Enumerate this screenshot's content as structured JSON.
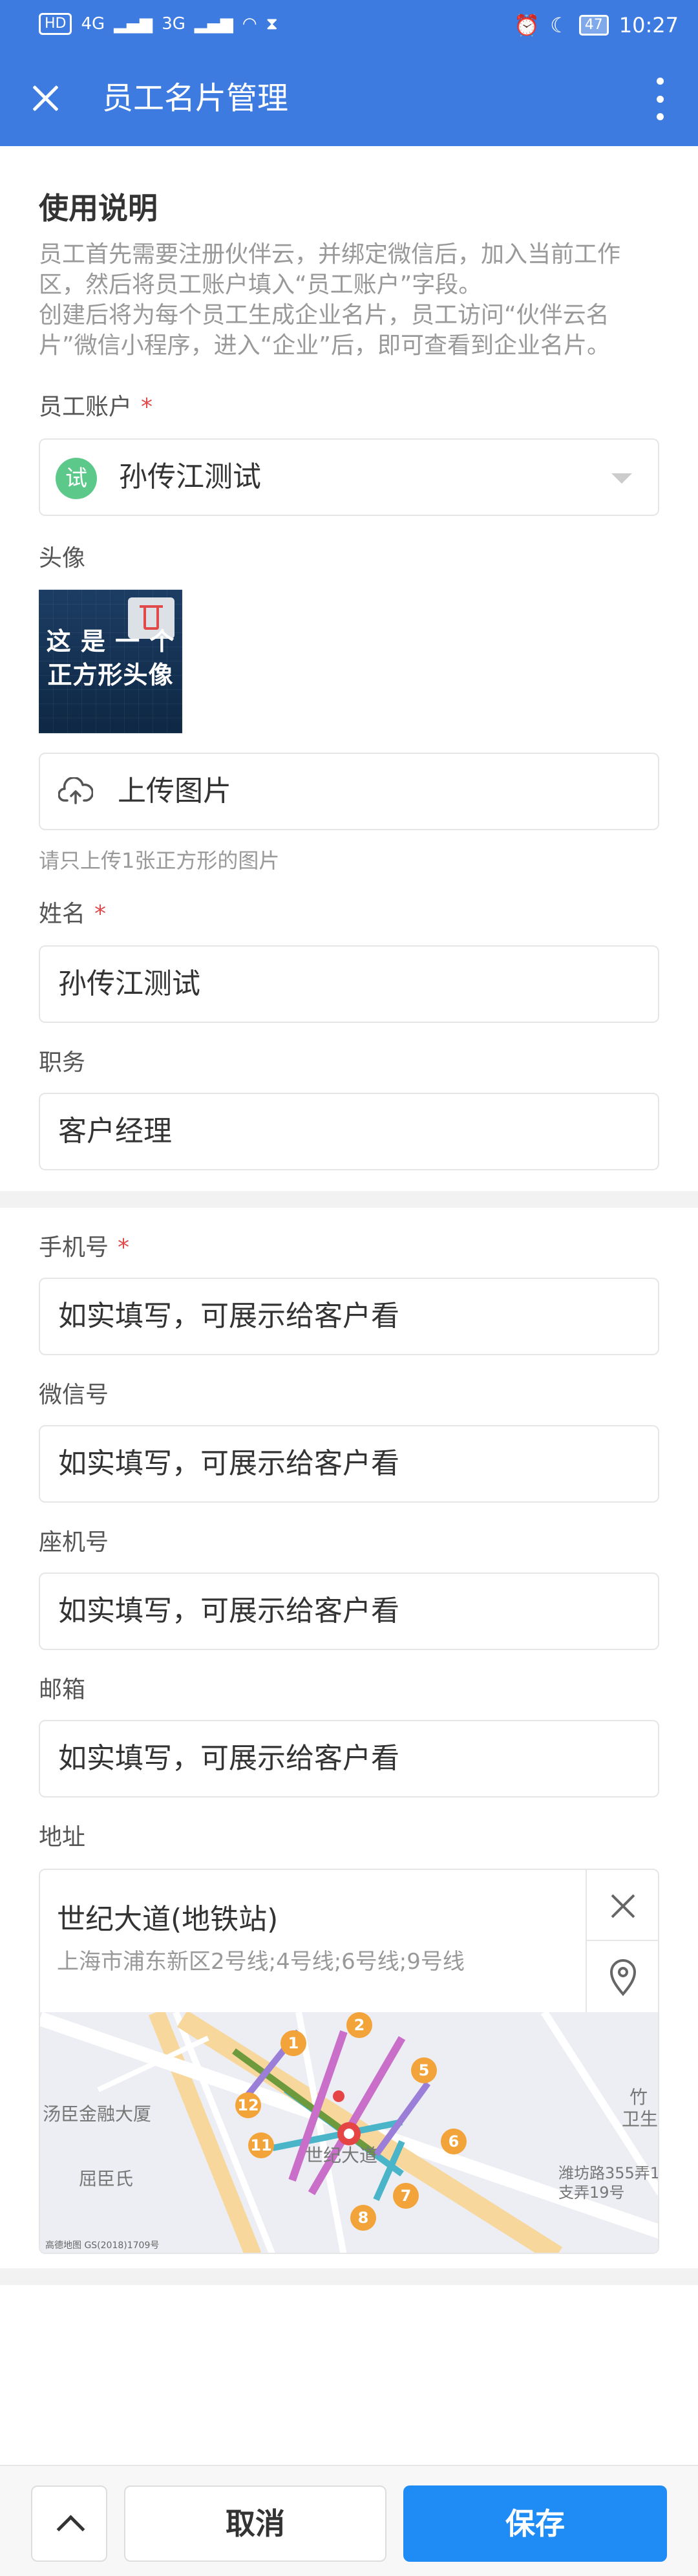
{
  "status_bar": {
    "left_indicators": [
      "HD",
      "4G",
      "3G"
    ],
    "time": "10:27",
    "battery": "47"
  },
  "app_bar": {
    "title": "员工名片管理"
  },
  "instructions": {
    "title": "使用说明",
    "paragraph_1": "员工首先需要注册伙伴云，并绑定微信后，加入当前工作区，然后将员工账户填入“员工账户”字段。",
    "paragraph_2": "创建后将为每个员工生成企业名片，员工访问“伙伴云名片”微信小程序，进入“企业”后，即可查看到企业名片。"
  },
  "form": {
    "account": {
      "label": "员工账户",
      "required_mark": "*",
      "badge": "试",
      "value": "孙传江测试"
    },
    "avatar": {
      "label": "头像",
      "image_caption_line1": "这 是 一 个",
      "image_caption_line2": "正方形头像",
      "upload_label": "上传图片",
      "hint": "请只上传1张正方形的图片"
    },
    "name": {
      "label": "姓名",
      "required_mark": "*",
      "value": "孙传江测试"
    },
    "position": {
      "label": "职务",
      "value": "客户经理"
    },
    "phone": {
      "label": "手机号",
      "required_mark": "*",
      "placeholder": "如实填写，可展示给客户看"
    },
    "wechat": {
      "label": "微信号",
      "placeholder": "如实填写，可展示给客户看"
    },
    "landline": {
      "label": "座机号",
      "placeholder": "如实填写，可展示给客户看"
    },
    "email": {
      "label": "邮箱",
      "placeholder": "如实填写，可展示给客户看"
    },
    "address": {
      "label": "地址",
      "name": "世纪大道(地铁站)",
      "detail": "上海市浦东新区2号线;4号线;6号线;9号线",
      "map": {
        "labels": [
          "汤臣金融大厦",
          "屈臣氏",
          "世纪大道",
          "潍坊路355弄1支弄19号",
          "竹",
          "卫生"
        ],
        "line_numbers": [
          "1",
          "2",
          "5",
          "6",
          "7",
          "8",
          "11",
          "12"
        ],
        "copyright": "高德地图 GS(2018)1709号"
      }
    }
  },
  "bottom_bar": {
    "cancel_label": "取消",
    "save_label": "保存"
  },
  "colors": {
    "header": "#3d7be0",
    "save_button": "#1f8cf5",
    "required": "#e04a4a",
    "badge": "#5cc98a"
  }
}
